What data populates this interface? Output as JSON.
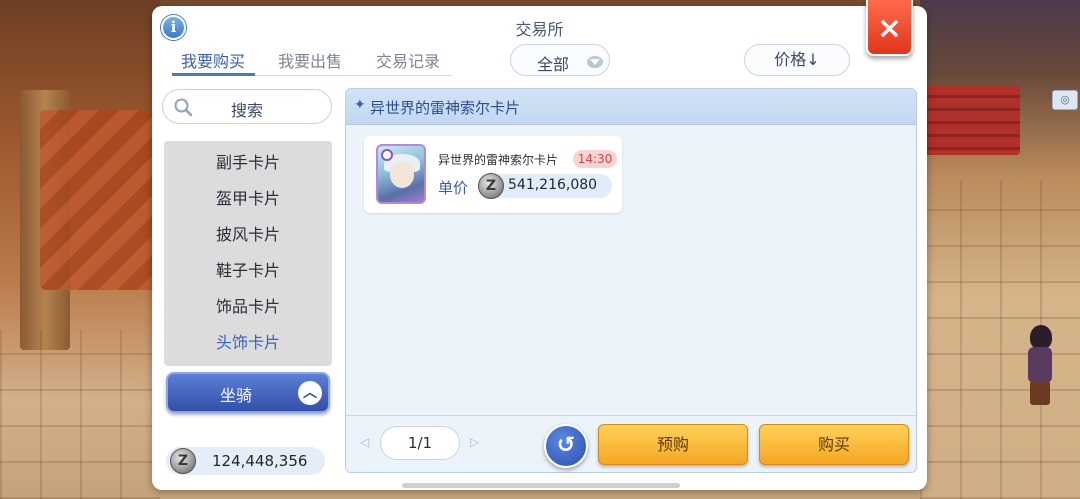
{
  "window": {
    "title": "交易所",
    "info_label": "i",
    "close_label": "×"
  },
  "tabs": [
    {
      "label": "我要购买",
      "active": true
    },
    {
      "label": "我要出售",
      "active": false
    },
    {
      "label": "交易记录",
      "active": false
    }
  ],
  "filter": {
    "selected": "全部"
  },
  "sort": {
    "label": "价格↓"
  },
  "search": {
    "label": "搜索"
  },
  "categories": [
    {
      "label": "副手卡片",
      "active": false
    },
    {
      "label": "盔甲卡片",
      "active": false
    },
    {
      "label": "披风卡片",
      "active": false
    },
    {
      "label": "鞋子卡片",
      "active": false
    },
    {
      "label": "饰品卡片",
      "active": false
    },
    {
      "label": "头饰卡片",
      "active": true
    }
  ],
  "mount_button": {
    "label": "坐骑"
  },
  "balance": {
    "currency_symbol": "Z",
    "value": "124,448,356"
  },
  "content": {
    "header": "异世界的雷神索尔卡片",
    "header_glyph": "✦",
    "items": [
      {
        "name": "异世界的雷神索尔卡片",
        "time": "14:30",
        "price_label": "单价",
        "currency_symbol": "Z",
        "price": "541,216,080"
      }
    ]
  },
  "pager": {
    "current": "1/1",
    "prev_glyph": "◁",
    "next_glyph": "▷"
  },
  "buttons": {
    "refresh_glyph": "↺",
    "preorder": "预购",
    "buy": "购买"
  },
  "colors": {
    "accent": "#3a5fa8",
    "close": "#e0351c",
    "action": "#f5a623"
  }
}
